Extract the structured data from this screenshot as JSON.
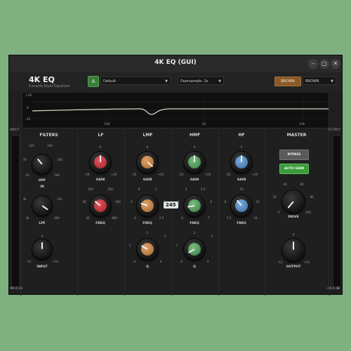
{
  "window": {
    "title": "4K EQ (GUI)",
    "minimize": "–",
    "maximize": "▢",
    "close": "✕"
  },
  "header": {
    "brand": "4K EQ",
    "subtitle": "Console-Style Equalizer",
    "a_button": "A",
    "preset": "Default",
    "oversample": "Oversample: 2x",
    "brown_button": "BROWN",
    "brown_select": "BROWN"
  },
  "display": {
    "y_ticks": [
      "+20",
      "0",
      "-20"
    ],
    "x_ticks": [
      "100",
      "1k",
      "10k"
    ]
  },
  "meters": {
    "input_label": "INPUT",
    "output_label": "OUTPUT",
    "input_db": "-96.0 dB",
    "output_db": "-96.0 dB"
  },
  "sections": {
    "filters": {
      "title": "FILTERS",
      "hpf": {
        "label": "HPF",
        "ticks": [
          "120",
          "200",
          "70",
          "300",
          "20",
          "500",
          "IN"
        ]
      },
      "lpf": {
        "label": "LPF",
        "ticks": [
          "3k",
          "12k",
          "3k",
          "20k"
        ]
      },
      "input": {
        "label": "INPUT",
        "ticks": [
          "0",
          "-12",
          "+12"
        ]
      }
    },
    "lf": {
      "title": "LF",
      "gain": {
        "label": "GAIN",
        "ticks": [
          "0",
          "-20",
          "+20"
        ]
      },
      "freq": {
        "label": "FREQ",
        "ticks": [
          "100",
          "200",
          "50",
          "300",
          "30",
          "480"
        ]
      }
    },
    "lmf": {
      "title": "LMF",
      "gain": {
        "label": "GAIN",
        "ticks": [
          "0",
          "-20",
          "+20"
        ]
      },
      "freq": {
        "label": "FREQ",
        "ticks": [
          "8",
          "1",
          ".5",
          "2",
          ".2",
          "2.5"
        ]
      },
      "q": {
        "label": "Q",
        "ticks": [
          "2",
          "1",
          "3",
          ".4",
          "4"
        ]
      },
      "tooltip": "245"
    },
    "hmf": {
      "title": "HMF",
      "gain": {
        "label": "GAIN",
        "ticks": [
          "0",
          "-20",
          "+20"
        ]
      },
      "freq": {
        "label": "FREQ",
        "ticks": [
          "3",
          "4.5",
          "1",
          "6",
          ".6",
          "7"
        ]
      },
      "q": {
        "label": "Q",
        "ticks": [
          "2",
          "1",
          "3",
          ".4",
          "4"
        ]
      }
    },
    "hf": {
      "title": "HF",
      "gain": {
        "label": "GAIN",
        "ticks": [
          "0",
          "-20",
          "+20"
        ]
      },
      "freq": {
        "label": "FREQ",
        "ticks": [
          "10",
          "8",
          "14",
          "1.5",
          "16"
        ]
      }
    },
    "master": {
      "title": "MASTER",
      "bypass": "BYPASS",
      "auto_gain": "AUTO GAIN",
      "drive": {
        "label": "DRIVE",
        "ticks": [
          "40",
          "60",
          "20",
          "80",
          "0",
          "100"
        ]
      },
      "output": {
        "label": "OUTPUT",
        "ticks": [
          "0",
          "-12",
          "+12"
        ]
      }
    }
  },
  "colors": {
    "red": "#c9343b",
    "orange": "#c98a4f",
    "green": "#4f9b57",
    "blue": "#4f86c1",
    "dark": "#3c3c3c"
  }
}
